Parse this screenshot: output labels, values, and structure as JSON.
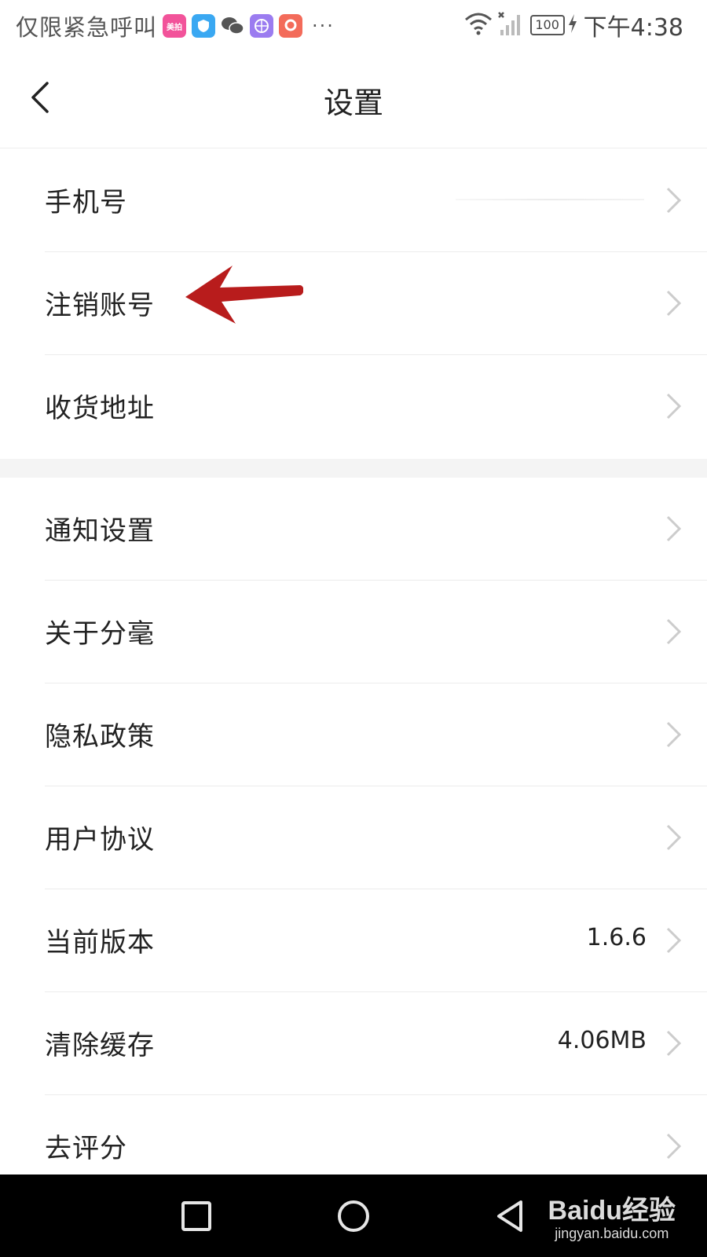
{
  "status_bar": {
    "carrier_text": "仅限紧急呼叫",
    "app_icons": [
      {
        "name": "meipai-icon",
        "color": "#f2539a",
        "label": "美拍"
      },
      {
        "name": "shield-app-icon",
        "color": "#3aa8f2",
        "label": ""
      },
      {
        "name": "wechat-icon",
        "color": "#555555",
        "label": ""
      },
      {
        "name": "browser-app-icon",
        "color": "#9b7cf0",
        "label": ""
      },
      {
        "name": "app-icon",
        "color": "#f36b5a",
        "label": ""
      }
    ],
    "more": "···",
    "battery": "100",
    "time": "下午4:38"
  },
  "header": {
    "title": "设置",
    "back_icon": "chevron-left-icon"
  },
  "groups": [
    {
      "items": [
        {
          "label": "手机号",
          "value": "",
          "masked": true
        },
        {
          "label": "注销账号",
          "value": ""
        },
        {
          "label": "收货地址",
          "value": ""
        }
      ]
    },
    {
      "items": [
        {
          "label": "通知设置",
          "value": ""
        },
        {
          "label": "关于分毫",
          "value": ""
        },
        {
          "label": "隐私政策",
          "value": ""
        },
        {
          "label": "用户协议",
          "value": ""
        },
        {
          "label": "当前版本",
          "value": "1.6.6"
        },
        {
          "label": "清除缓存",
          "value": "4.06MB"
        },
        {
          "label": "去评分",
          "value": ""
        }
      ]
    }
  ],
  "annotation": {
    "color": "#b81c1c",
    "target": "注销账号"
  },
  "nav_bar": {
    "buttons": [
      "recent-apps-icon",
      "home-icon",
      "back-icon"
    ],
    "watermark_logo": "Baidu经验",
    "watermark_url": "jingyan.baidu.com"
  },
  "colors": {
    "chevron": "#cccccc",
    "separator": "#ececec",
    "band": "#f4f4f4"
  }
}
